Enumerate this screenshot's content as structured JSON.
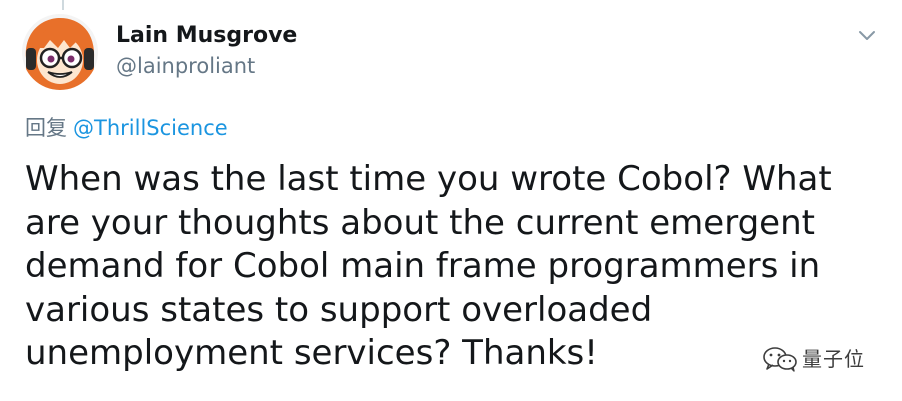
{
  "author": {
    "display_name": "Lain Musgrove",
    "handle": "@lainproliant"
  },
  "reply": {
    "prefix": "回复",
    "mention": "@ThrillScience"
  },
  "tweet": {
    "text": "When was the last time you wrote Cobol?  What\nare your thoughts about the current emergent\ndemand for Cobol main frame programmers in\nvarious states to support overloaded\nunemployment services?  Thanks!"
  },
  "watermark": {
    "text": "量子位",
    "icon": "wechat-icon"
  },
  "colors": {
    "text": "#14171a",
    "secondary": "#657786",
    "link": "#1b95e0",
    "avatar_hair": "#e8702a"
  },
  "icons": {
    "caret": "chevron-down-icon"
  }
}
